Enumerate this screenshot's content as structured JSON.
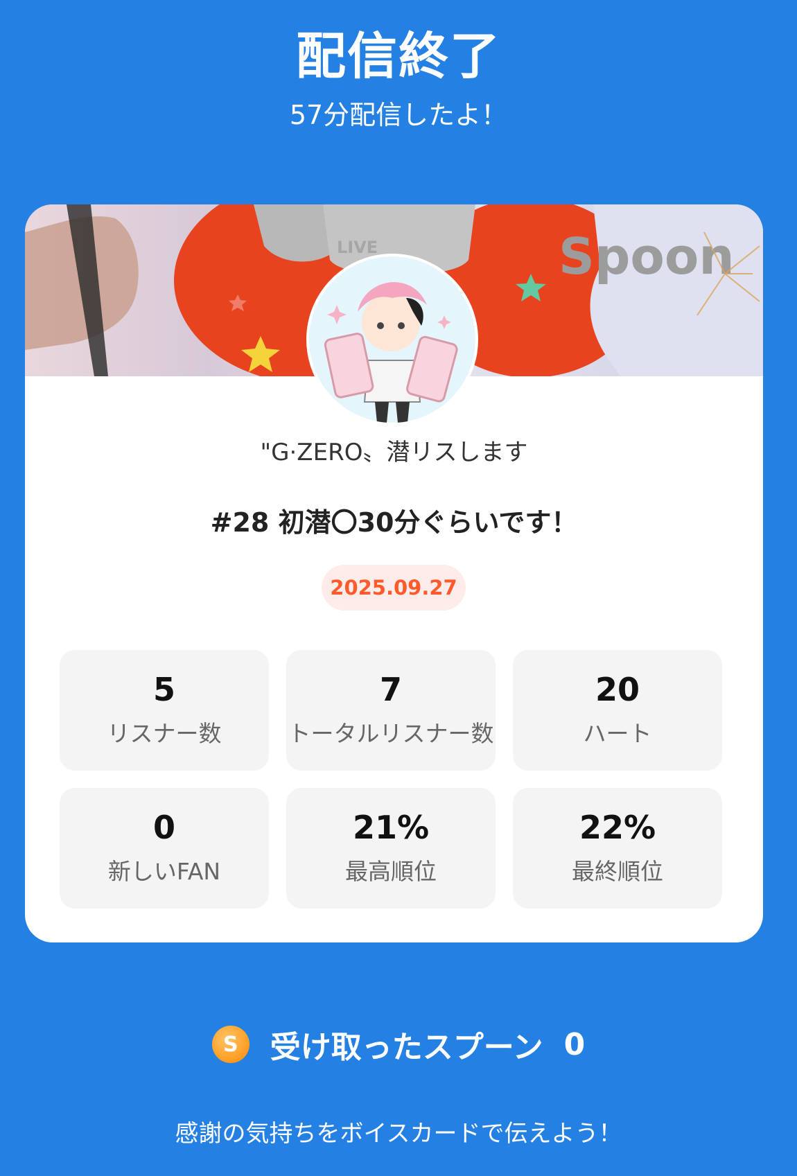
{
  "header": {
    "title": "配信終了",
    "subtitle": "57分配信したよ！"
  },
  "card": {
    "banner": {
      "brand_text": "Spoon",
      "live_text": "LIVE"
    },
    "username": "\"G·ZERO〟潜リスします",
    "broadcast_title": "#28 初潜〇30分ぐらいです！",
    "date": "2025.09.27",
    "stats": [
      {
        "value": "5",
        "label": "リスナー数"
      },
      {
        "value": "7",
        "label": "トータルリスナー数"
      },
      {
        "value": "20",
        "label": "ハート"
      },
      {
        "value": "0",
        "label": "新しいFAN"
      },
      {
        "value": "21%",
        "label": "最高順位"
      },
      {
        "value": "22%",
        "label": "最終順位"
      }
    ]
  },
  "spoons": {
    "icon_letter": "S",
    "label": "受け取ったスプーン",
    "count": "0"
  },
  "footer": {
    "message": "感謝の気持ちをボイスカードで伝えよう！"
  },
  "colors": {
    "background": "#2580e3",
    "date_text": "#ff5a2b",
    "date_bg": "#fdecea",
    "spoon_orange": "#ff8a00"
  }
}
